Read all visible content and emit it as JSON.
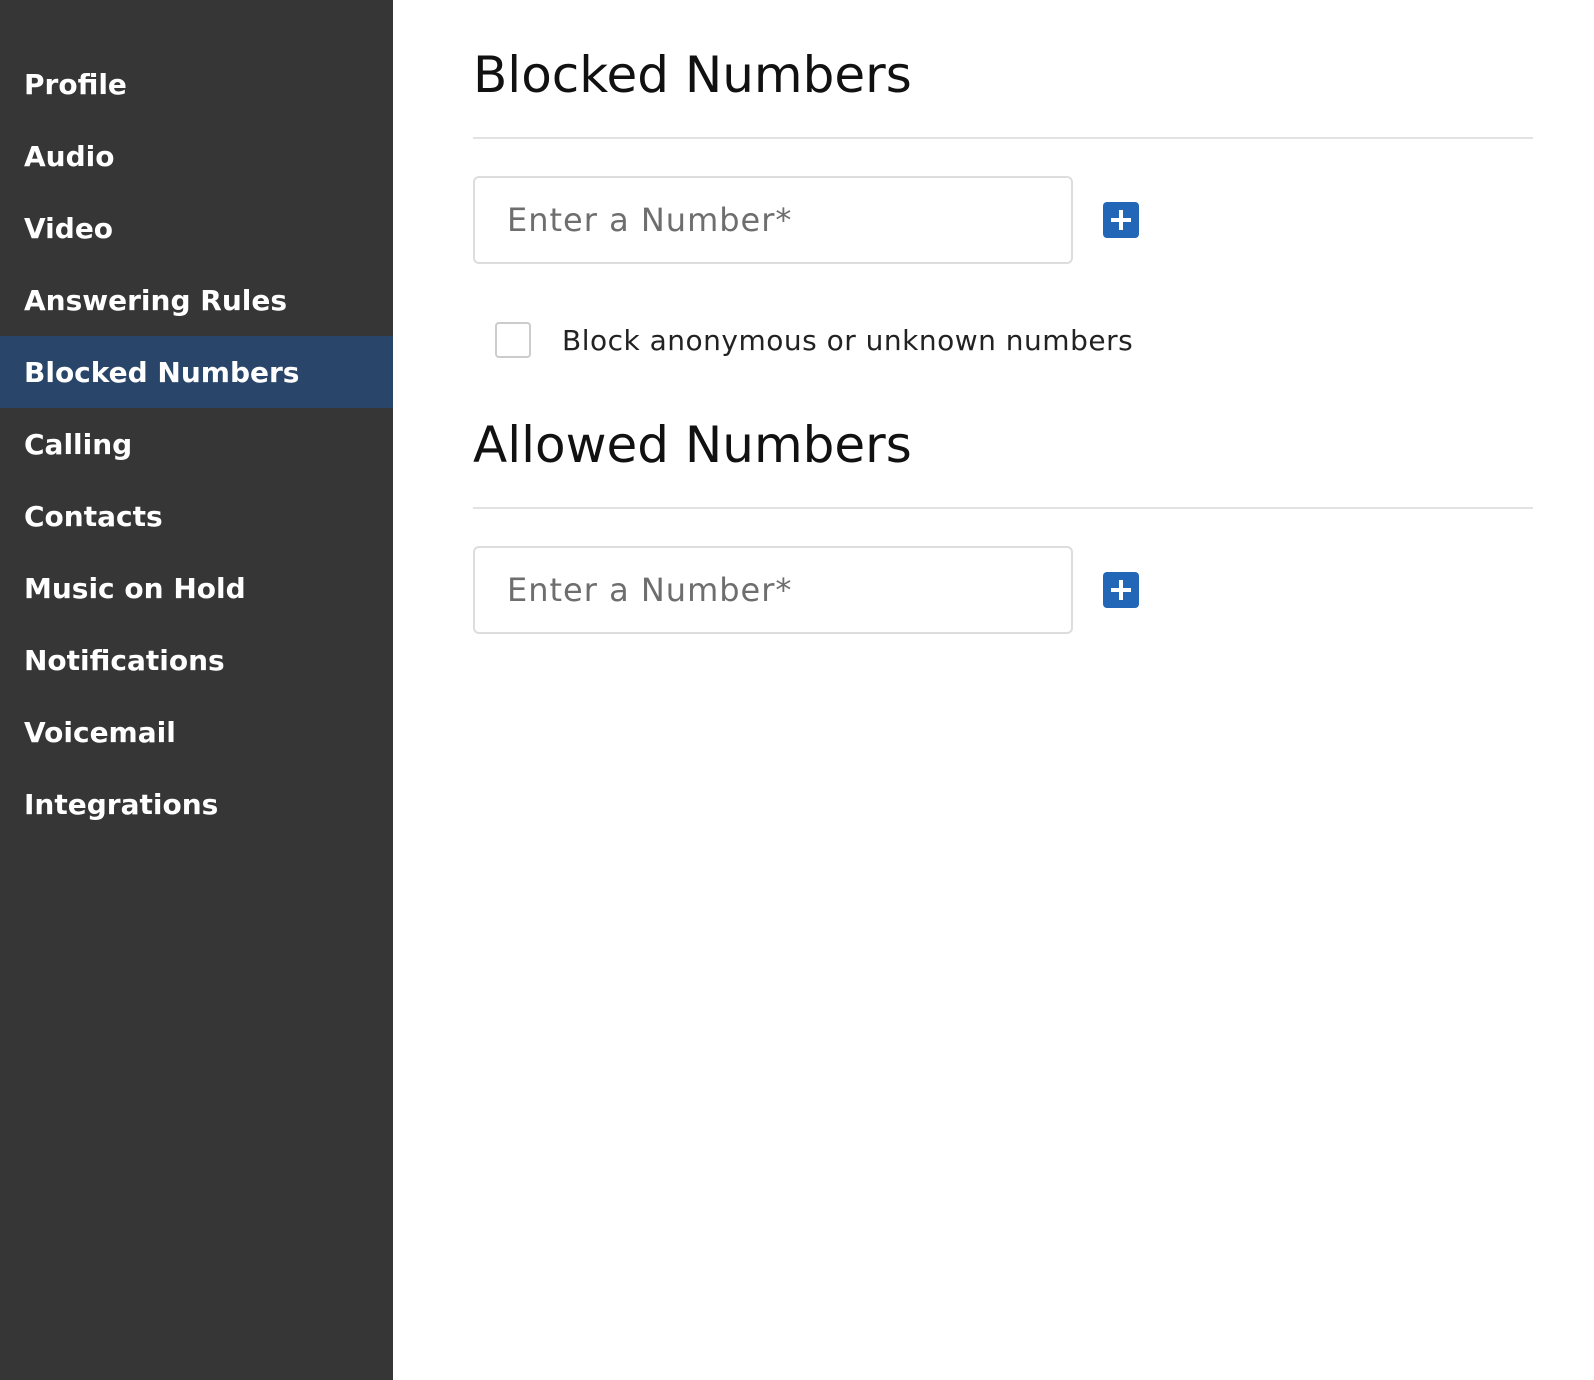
{
  "sidebar": {
    "items": [
      {
        "label": "Profile"
      },
      {
        "label": "Audio"
      },
      {
        "label": "Video"
      },
      {
        "label": "Answering Rules"
      },
      {
        "label": "Blocked Numbers",
        "active": true
      },
      {
        "label": "Calling"
      },
      {
        "label": "Contacts"
      },
      {
        "label": "Music on Hold"
      },
      {
        "label": "Notifications"
      },
      {
        "label": "Voicemail"
      },
      {
        "label": "Integrations"
      }
    ]
  },
  "blocked": {
    "title": "Blocked Numbers",
    "input_placeholder": "Enter a Number*",
    "input_value": "",
    "add_icon": "plus-icon",
    "checkbox_label": "Block anonymous or unknown numbers",
    "checkbox_checked": false
  },
  "allowed": {
    "title": "Allowed Numbers",
    "input_placeholder": "Enter a Number*",
    "input_value": "",
    "add_icon": "plus-icon"
  },
  "colors": {
    "sidebar_bg": "#363636",
    "active_item_bg": "#29466a",
    "accent": "#2266b8"
  }
}
